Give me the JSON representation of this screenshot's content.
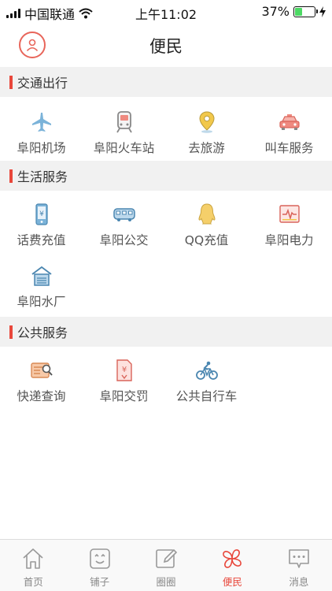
{
  "status_bar": {
    "carrier": "中国联通",
    "time": "上午11:02",
    "battery_text": "37%",
    "battery_level": 0.37
  },
  "header": {
    "title": "便民"
  },
  "sections": [
    {
      "title": "交通出行",
      "items": [
        {
          "label": "阜阳机场",
          "icon": "airplane-icon"
        },
        {
          "label": "阜阳火车站",
          "icon": "train-icon"
        },
        {
          "label": "去旅游",
          "icon": "location-pin-icon"
        },
        {
          "label": "叫车服务",
          "icon": "taxi-icon"
        }
      ]
    },
    {
      "title": "生活服务",
      "items": [
        {
          "label": "话费充值",
          "icon": "phone-bill-icon"
        },
        {
          "label": "阜阳公交",
          "icon": "bus-icon"
        },
        {
          "label": "QQ充值",
          "icon": "qq-icon"
        },
        {
          "label": "阜阳电力",
          "icon": "electricity-icon"
        },
        {
          "label": "阜阳水厂",
          "icon": "water-plant-icon"
        }
      ]
    },
    {
      "title": "公共服务",
      "items": [
        {
          "label": "快递查询",
          "icon": "express-search-icon"
        },
        {
          "label": "阜阳交罚",
          "icon": "traffic-fine-icon"
        },
        {
          "label": "公共自行车",
          "icon": "bicycle-icon"
        }
      ]
    }
  ],
  "tab_bar": {
    "tabs": [
      {
        "label": "首页",
        "icon": "home-icon"
      },
      {
        "label": "铺子",
        "icon": "shop-icon"
      },
      {
        "label": "圈圈",
        "icon": "edit-icon"
      },
      {
        "label": "便民",
        "icon": "clover-icon",
        "active": true
      },
      {
        "label": "消息",
        "icon": "message-icon"
      }
    ]
  },
  "colors": {
    "accent": "#e8473b",
    "section_bg": "#f1f1f1",
    "icon_blue": "#7bb3d9",
    "icon_yellow": "#f2c84b",
    "icon_red": "#ef8a80"
  }
}
